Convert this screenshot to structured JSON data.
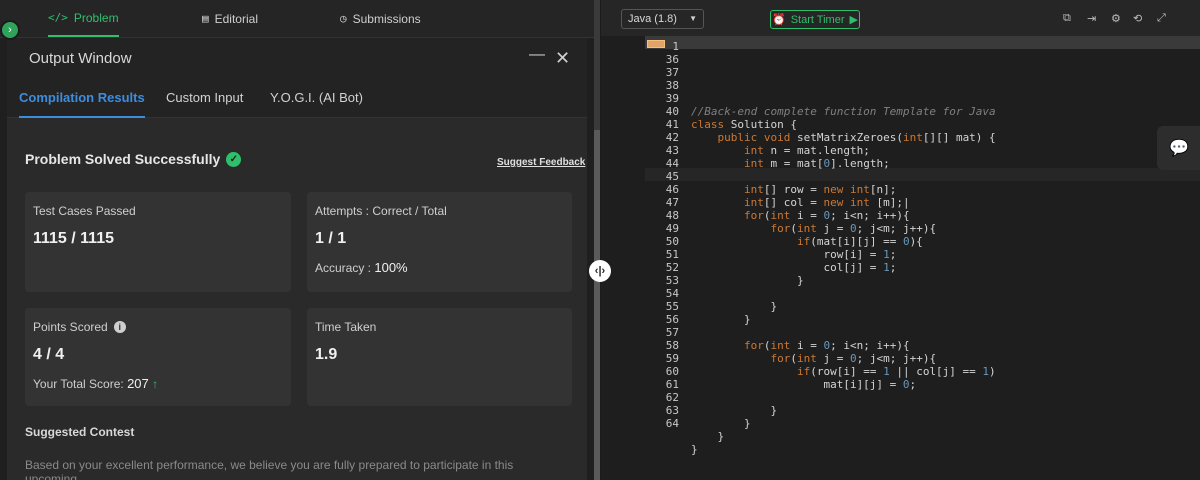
{
  "top_tabs": {
    "problem": "Problem",
    "editorial": "Editorial",
    "submissions": "Submissions"
  },
  "output_window": {
    "title": "Output Window",
    "minimize": "—",
    "close": "✕"
  },
  "sub_tabs": {
    "compilation": "Compilation Results",
    "custom_input": "Custom Input",
    "yogi": "Y.O.G.I. (AI Bot)"
  },
  "results": {
    "status": "Problem Solved Successfully",
    "feedback_link": "Suggest Feedback",
    "test_cases_label": "Test Cases Passed",
    "test_cases_value": "1115 / 1115",
    "attempts_label": "Attempts : Correct / Total",
    "attempts_value": "1 / 1",
    "accuracy_label": "Accuracy :",
    "accuracy_value": "100%",
    "points_label": "Points Scored",
    "points_value": "4 / 4",
    "total_score_label": "Your Total Score:",
    "total_score_value": "207",
    "time_label": "Time Taken",
    "time_value": "1.9"
  },
  "suggested": {
    "heading": "Suggested Contest",
    "text": "Based on your excellent performance, we believe you are fully prepared to participate in this upcoming"
  },
  "editor": {
    "language": "Java (1.8)",
    "timer_label": "Start Timer",
    "line_numbers": [
      "1",
      "36",
      "37",
      "38",
      "39",
      "40",
      "41",
      "42",
      "43",
      "44",
      "45",
      "46",
      "47",
      "48",
      "49",
      "50",
      "51",
      "52",
      "53",
      "54",
      "55",
      "56",
      "57",
      "58",
      "59",
      "60",
      "61",
      "62",
      "63",
      "64"
    ]
  },
  "icons": {
    "problem": "code-icon",
    "editorial": "document-icon",
    "submissions": "clock-icon",
    "check": "check-circle-icon",
    "info": "info-icon",
    "arrow": "arrow-up-icon",
    "toolbar": [
      "copy-icon",
      "exit-icon",
      "settings-icon",
      "fullscreen-icon"
    ],
    "chat": "chat-icon"
  },
  "colors": {
    "accent_green": "#2fbf6c",
    "accent_blue": "#3d8ddf"
  }
}
